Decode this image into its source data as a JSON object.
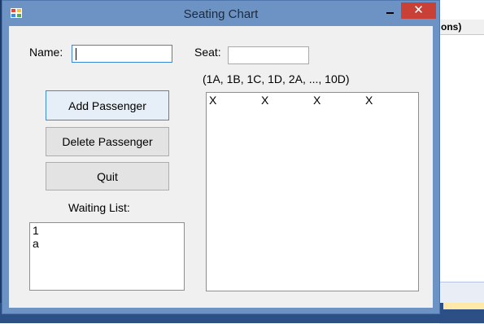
{
  "background_app": {
    "header_fragment": "ons)"
  },
  "window": {
    "title": "Seating Chart",
    "close_glyph": "✕"
  },
  "form": {
    "name_label": "Name:",
    "name_value": "",
    "seat_label": "Seat:",
    "seat_value": "",
    "seat_hint": "(1A, 1B, 1C, 1D, 2A, ..., 10D)",
    "add_button": "Add Passenger",
    "delete_button": "Delete Passenger",
    "quit_button": "Quit",
    "waiting_label": "Waiting List:",
    "waiting_list": [
      "1",
      "a"
    ],
    "seating_rows": [
      [
        "X",
        "X",
        "X",
        "X"
      ]
    ]
  }
}
